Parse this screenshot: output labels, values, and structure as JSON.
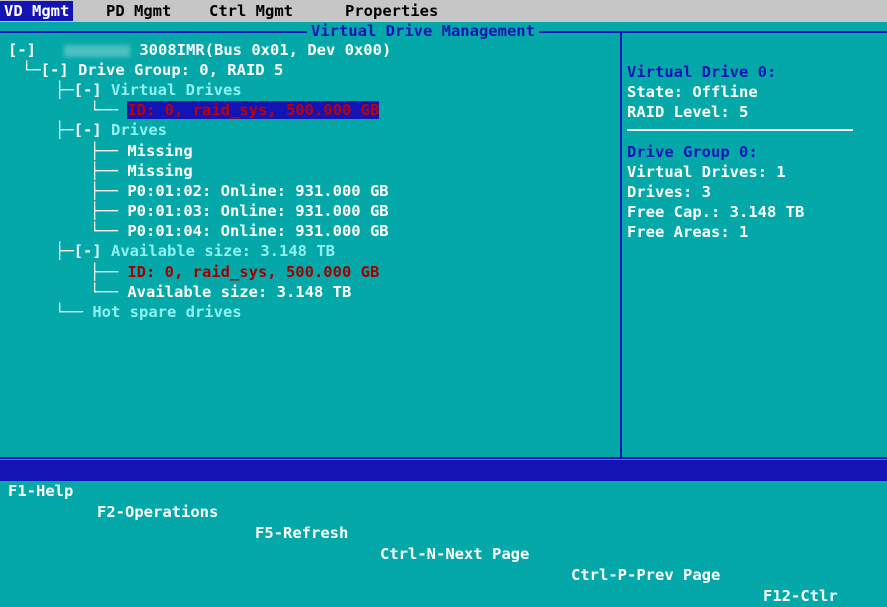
{
  "tabs": [
    "VD Mgmt",
    "PD Mgmt",
    "Ctrl Mgmt",
    "Properties"
  ],
  "frame_title": "Virtual Drive Management",
  "tree": {
    "root_toggle": "[-]",
    "controller": "3008IMR(Bus 0x01, Dev 0x00)",
    "drive_group": "[-] Drive Group: 0, RAID 5",
    "virtual_drives_toggle": "[-]",
    "virtual_drives_label": "Virtual Drives",
    "vd_entry": "ID: 0, raid_sys, 500.000 GB",
    "drives_toggle": "[-]",
    "drives_label": "Drives",
    "drives": [
      "Missing",
      "Missing",
      "P0:01:02: Online: 931.000 GB",
      "P0:01:03: Online: 931.000 GB",
      "P0:01:04: Online: 931.000 GB"
    ],
    "avail_toggle": "[-]",
    "avail_label": "Available size: 3.148 TB",
    "avail_children": [
      "ID: 0, raid_sys, 500.000 GB",
      "Available size: 3.148 TB"
    ],
    "hot_spare": "Hot spare drives"
  },
  "details": {
    "vd_title": "Virtual Drive 0:",
    "vd_lines": [
      "State: Offline",
      "RAID Level: 5"
    ],
    "dg_title": "Drive Group 0:",
    "dg_lines": [
      "Virtual Drives: 1",
      "Drives: 3",
      "Free Cap.: 3.148 TB",
      "Free Areas: 1"
    ]
  },
  "footer": [
    "F1-Help",
    "F2-Operations",
    "F5-Refresh",
    "Ctrl-N-Next Page",
    "Ctrl-P-Prev Page",
    "F12-Ctlr"
  ]
}
